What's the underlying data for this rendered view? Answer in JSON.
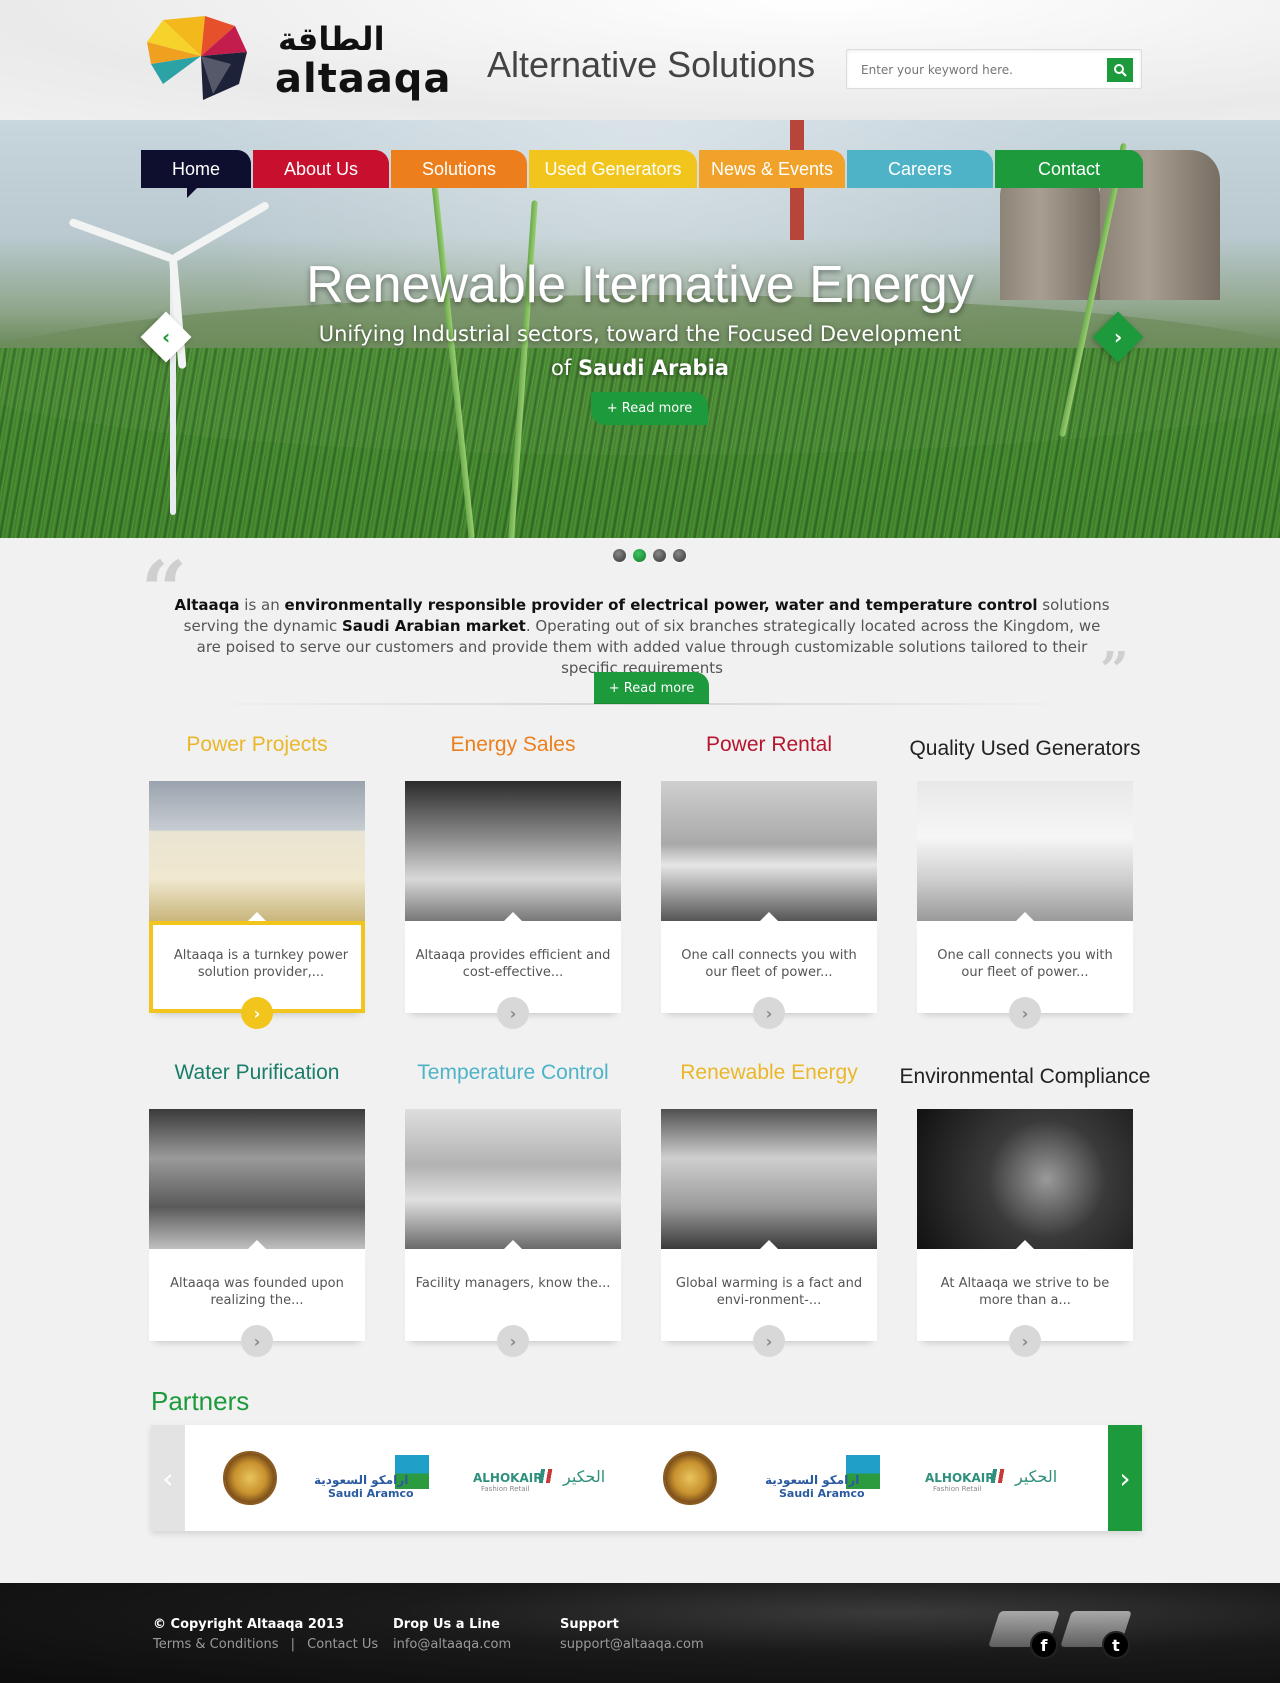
{
  "header": {
    "logo_arabic": "الطاقة",
    "logo_english": "altaaqa",
    "tagline": "Alternative Solutions",
    "search_placeholder": "Enter your keyword here."
  },
  "nav": {
    "items": [
      {
        "label": "Home",
        "color": "#0e0f2e"
      },
      {
        "label": "About Us",
        "color": "#c8102e"
      },
      {
        "label": "Solutions",
        "color": "#ec7f1c"
      },
      {
        "label": "Used Generators",
        "color": "#f2c51c"
      },
      {
        "label": "News & Events",
        "color": "#f0a22a"
      },
      {
        "label": "Careers",
        "color": "#4fb3c8"
      },
      {
        "label": "Contact",
        "color": "#1c9a3c"
      }
    ]
  },
  "hero": {
    "title": "Renewable Iternative Energy",
    "subtitle_line1": "Unifying Industrial sectors, toward the Focused Development",
    "subtitle_of": "of",
    "subtitle_bold": "Saudi Arabia",
    "button": "+ Read more",
    "slide_count": 4,
    "active_slide": 2
  },
  "intro": {
    "brand": "Altaaqa",
    "text1": " is an ",
    "bold1": "environmentally responsible provider of electrical power, water and temperature control",
    "text2": " solutions serving the dynamic ",
    "bold2": "Saudi Arabian market",
    "text3": ". Operating out of six branches strategically located across the Kingdom, we are poised to serve our customers and provide them with added value through customizable solutions tailored to their specific requirements",
    "button": "+ Read more"
  },
  "services": [
    {
      "title": "Power Projects",
      "color": "#eab72a",
      "text": "Altaaqa is a turnkey power solution provider,..."
    },
    {
      "title": "Energy Sales",
      "color": "#ec7f1c",
      "text": "Altaaqa provides efficient and cost-effective..."
    },
    {
      "title": "Power Rental",
      "color": "#b5162e",
      "text": "One call connects you with our fleet of power..."
    },
    {
      "title": "Quality Used Generators",
      "color": "#222222",
      "text": "One call connects you with our fleet of power..."
    },
    {
      "title": "Water Purification",
      "color": "#1a7d6a",
      "text": "Altaaqa was founded upon realizing the..."
    },
    {
      "title": "Temperature Control",
      "color": "#4fb3c8",
      "text": "Facility managers, know the..."
    },
    {
      "title": "Renewable Energy",
      "color": "#eab72a",
      "text": "Global warming is a fact and envi-ronment-..."
    },
    {
      "title": "Environmental Compliance",
      "color": "#222222",
      "text": "At Altaaqa we strive to be more than a..."
    }
  ],
  "partners": {
    "title": "Partners",
    "items": [
      {
        "type": "seal",
        "name": "Kingdom of Saudi Arabia"
      },
      {
        "type": "aramco",
        "arabic": "ارامكو السعودية",
        "english": "Saudi Aramco"
      },
      {
        "type": "alhokair",
        "english": "ALHOKAIR",
        "sub": "Fashion Retail",
        "arabic": "الحكير"
      },
      {
        "type": "seal",
        "name": "Kingdom of Saudi Arabia"
      },
      {
        "type": "aramco",
        "arabic": "ارامكو السعودية",
        "english": "Saudi Aramco"
      },
      {
        "type": "alhokair",
        "english": "ALHOKAIR",
        "sub": "Fashion Retail",
        "arabic": "الحكير"
      }
    ]
  },
  "footer": {
    "copyright": "© Copyright Altaaqa 2013",
    "terms": "Terms & Conditions",
    "separator": "|",
    "contact": "Contact Us",
    "drop_title": "Drop Us a Line",
    "drop_email": "info@altaaqa.com",
    "support_title": "Support",
    "support_email": "support@altaaqa.com",
    "social": [
      {
        "icon": "facebook-icon",
        "glyph": "f"
      },
      {
        "icon": "twitter-icon",
        "glyph": "t"
      }
    ]
  }
}
